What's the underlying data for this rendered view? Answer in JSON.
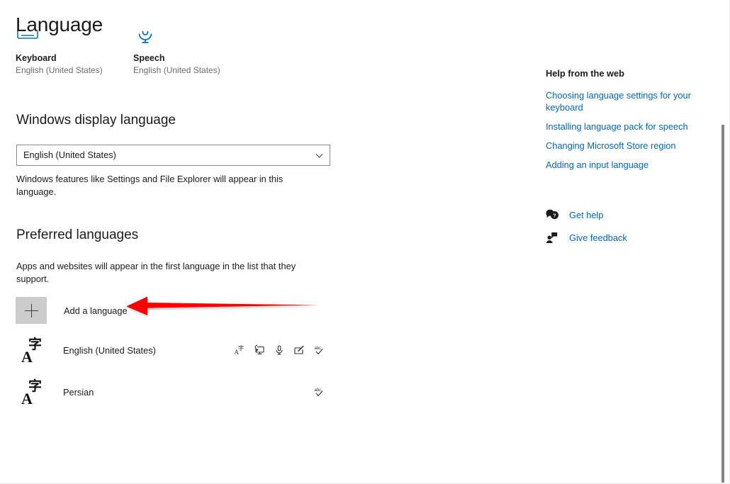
{
  "page": {
    "title": "Language"
  },
  "quick_tiles": [
    {
      "icon": "keyboard-icon",
      "name": "Keyboard",
      "value": "English (United States)"
    },
    {
      "icon": "speech-microphone-icon",
      "name": "Speech",
      "value": "English (United States)"
    }
  ],
  "display_language": {
    "heading": "Windows display language",
    "selected": "English (United States)",
    "description": "Windows features like Settings and File Explorer will appear in this language."
  },
  "preferred_languages": {
    "heading": "Preferred languages",
    "description": "Apps and websites will appear in the first language in the list that they support.",
    "add_label": "Add a language",
    "items": [
      {
        "name": "English (United States)",
        "features": [
          "language-pack-icon",
          "display-language-icon",
          "speech-microphone-icon",
          "handwriting-pen-icon",
          "spellcheck-abc-icon"
        ]
      },
      {
        "name": "Persian",
        "features": [
          "spellcheck-abc-icon"
        ]
      }
    ]
  },
  "help_rail": {
    "heading": "Help from the web",
    "links": [
      "Choosing language settings for your keyboard",
      "Installing language pack for speech",
      "Changing Microsoft Store region",
      "Adding an input language"
    ],
    "support": [
      {
        "icon": "get-help-icon",
        "label": "Get help"
      },
      {
        "icon": "give-feedback-icon",
        "label": "Give feedback"
      }
    ]
  },
  "colors": {
    "accent_link": "#0067c0",
    "tile_icon": "#0a72c4",
    "annotation_arrow": "#fe0000",
    "add_button_bg": "#cccccc",
    "scrollbar_thumb": "#868686"
  }
}
